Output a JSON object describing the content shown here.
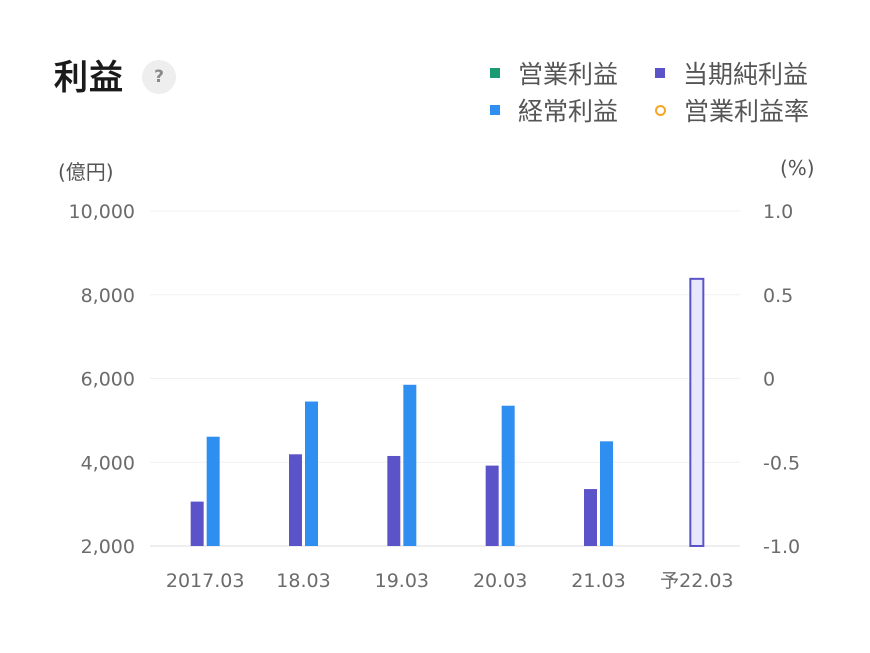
{
  "header": {
    "title": "利益",
    "help_icon_glyph": "?"
  },
  "legend": [
    {
      "label": "営業利益",
      "color": "#1a9b73",
      "marker": "square"
    },
    {
      "label": "当期純利益",
      "color": "#5b54c8",
      "marker": "square"
    },
    {
      "label": "経常利益",
      "color": "#2f8ff0",
      "marker": "square"
    },
    {
      "label": "営業利益率",
      "color": "#f5a623",
      "marker": "ring"
    }
  ],
  "chart_data": {
    "type": "bar",
    "categories": [
      "2017.03",
      "18.03",
      "19.03",
      "20.03",
      "21.03",
      "予22.03"
    ],
    "series": [
      {
        "name": "当期純利益",
        "color": "#5b54c8",
        "values": [
          3060,
          4190,
          4150,
          3920,
          3360,
          8380
        ],
        "forecast_index": 5
      },
      {
        "name": "経常利益",
        "color": "#2f8ff0",
        "values": [
          4610,
          5450,
          5850,
          5350,
          4500,
          null
        ]
      },
      {
        "name": "営業利益",
        "color": "#1a9b73",
        "values": [
          null,
          null,
          null,
          null,
          null,
          null
        ]
      },
      {
        "name": "営業利益率",
        "color": "#f5a623",
        "values": [
          null,
          null,
          null,
          null,
          null,
          null
        ]
      }
    ],
    "y_left": {
      "unit": "(億円)",
      "min": 2000,
      "max": 10000,
      "ticks": [
        "10,000",
        "8,000",
        "6,000",
        "4,000",
        "2,000"
      ],
      "tick_values": [
        10000,
        8000,
        6000,
        4000,
        2000
      ]
    },
    "y_right": {
      "unit": "(%)",
      "min": -1.0,
      "max": 1.0,
      "ticks": [
        "1.0",
        "0.5",
        "0",
        "-0.5",
        "-1.0"
      ],
      "tick_values": [
        1.0,
        0.5,
        0,
        -0.5,
        -1.0
      ]
    },
    "grid": true,
    "legend_position": "top-right"
  }
}
